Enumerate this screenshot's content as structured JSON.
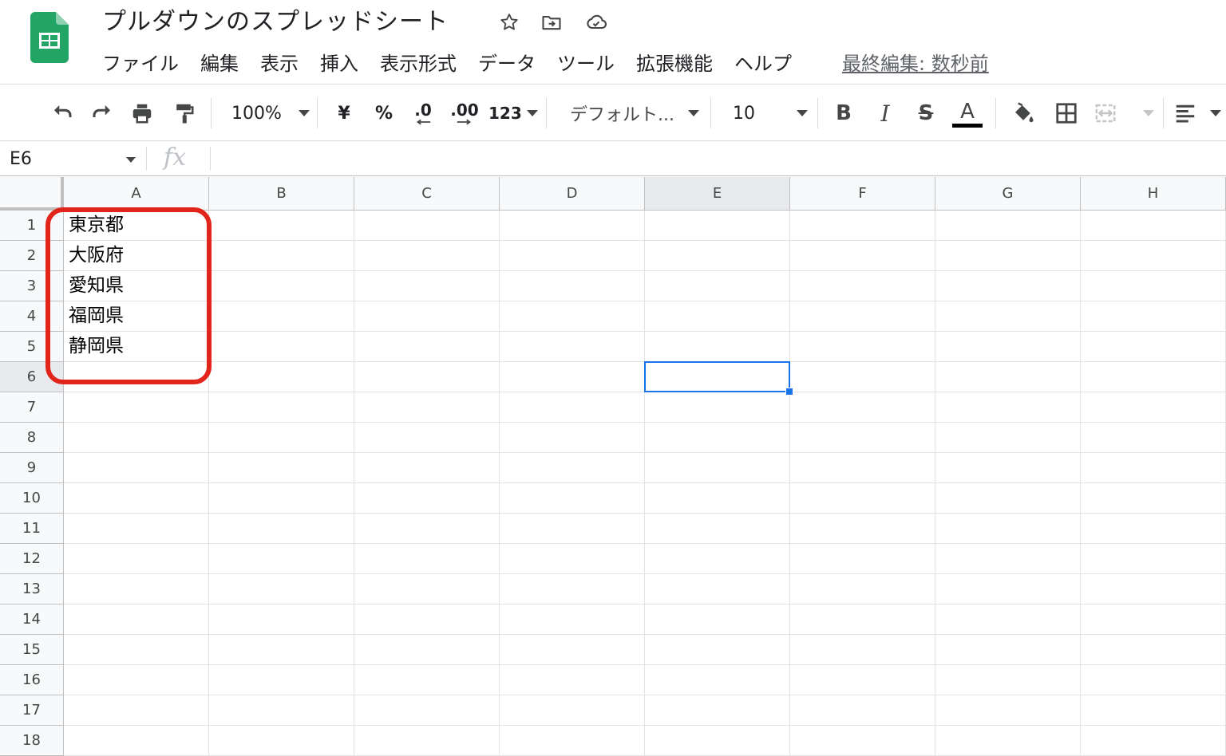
{
  "header": {
    "title": "プルダウンのスプレッドシート",
    "menu": [
      "ファイル",
      "編集",
      "表示",
      "挿入",
      "表示形式",
      "データ",
      "ツール",
      "拡張機能",
      "ヘルプ"
    ],
    "last_edit": "最終編集: 数秒前",
    "icons": [
      "star-icon",
      "move-to-folder-icon",
      "cloud-status-icon"
    ]
  },
  "toolbar": {
    "zoom": "100%",
    "currency": "¥",
    "percent": "%",
    "decrease_decimal": ".0",
    "increase_decimal": ".00",
    "number_format": "123",
    "font": "デフォルト...",
    "font_size": "10",
    "bold": "B",
    "italic": "I",
    "strike": "S",
    "text_color": "A",
    "text_color_underline": "#000000"
  },
  "formula_bar": {
    "cell_ref": "E6",
    "fx_label": "fx",
    "value": ""
  },
  "sheet": {
    "columns": [
      "A",
      "B",
      "C",
      "D",
      "E",
      "F",
      "G",
      "H"
    ],
    "rows": [
      "1",
      "2",
      "3",
      "4",
      "5",
      "6",
      "7",
      "8",
      "9",
      "10",
      "11",
      "12",
      "13",
      "14",
      "15",
      "16",
      "17",
      "18"
    ],
    "cells": {
      "A1": "東京都",
      "A2": "大阪府",
      "A3": "愛知県",
      "A4": "福岡県",
      "A5": "静岡県"
    },
    "selected": "E6",
    "selection_color": "#1a73e8",
    "highlight_color": "#e1251b"
  }
}
